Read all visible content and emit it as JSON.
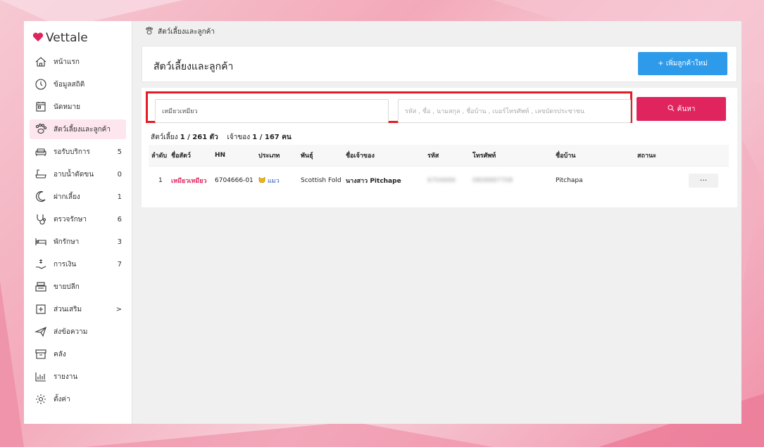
{
  "brand": {
    "name": "Vettale",
    "color": "#e0245e"
  },
  "sidebar": {
    "items": [
      {
        "label": "หน้าแรก",
        "icon": "home-icon",
        "count": ""
      },
      {
        "label": "ข้อมูลสถิติ",
        "icon": "clock-icon",
        "count": ""
      },
      {
        "label": "นัดหมาย",
        "icon": "calendar-icon",
        "count": ""
      },
      {
        "label": "สัตว์เลี้ยงและลูกค้า",
        "icon": "paw-icon",
        "count": "",
        "active": true
      },
      {
        "label": "รอรับบริการ",
        "icon": "sofa-icon",
        "count": "5"
      },
      {
        "label": "อาบน้ำตัดขน",
        "icon": "bathtub-icon",
        "count": "0"
      },
      {
        "label": "ฝากเลี้ยง",
        "icon": "moon-icon",
        "count": "1"
      },
      {
        "label": "ตรวจรักษา",
        "icon": "stethoscope-icon",
        "count": "6"
      },
      {
        "label": "พักรักษา",
        "icon": "bed-icon",
        "count": "3"
      },
      {
        "label": "การเงิน",
        "icon": "money-hand-icon",
        "count": "7"
      },
      {
        "label": "ขายปลีก",
        "icon": "cash-register-icon",
        "count": ""
      },
      {
        "label": "ส่วนเสริม",
        "icon": "plus-box-icon",
        "count": ">"
      },
      {
        "label": "ส่งข้อความ",
        "icon": "send-icon",
        "count": ""
      },
      {
        "label": "คลัง",
        "icon": "archive-icon",
        "count": ""
      },
      {
        "label": "รายงาน",
        "icon": "chart-icon",
        "count": ""
      },
      {
        "label": "ตั้งค่า",
        "icon": "gear-icon",
        "count": ""
      }
    ]
  },
  "breadcrumb": {
    "label": "สัตว์เลี้ยงและลูกค้า",
    "icon": "paw-icon"
  },
  "header": {
    "title": "สัตว์เลี้ยงและลูกค้า",
    "add_label": "+ เพิ่มลูกค้าใหม่"
  },
  "search": {
    "name_value": "เหมียวเหมียว",
    "query_placeholder": "รหัส , ชื่อ , นามสกุล , ชื่อบ้าน , เบอร์โทรศัพท์ , เลขบัตรประชาชน",
    "button_label": "ค้นหา"
  },
  "counts": {
    "pets_label": "สัตว์เลี้ยง",
    "pets_value": "1 / 261 ตัว",
    "owners_label": "เจ้าของ",
    "owners_value": "1 / 167 คน"
  },
  "table": {
    "headers": [
      "ลำดับ",
      "ชื่อสัตว์",
      "HN",
      "ประเภท",
      "พันธุ์",
      "ชื่อเจ้าของ",
      "รหัส",
      "โทรศัพท์",
      "ชื่อบ้าน",
      "สถานะ"
    ],
    "rows": [
      {
        "index": "1",
        "pet_name": "เหมียวเหมียว",
        "hn": "6704666-01",
        "type": "แมว",
        "breed": "Scottish Fold",
        "owner": "นางสาว Pitchape",
        "code": "6704666",
        "phone": "0808887708",
        "house_name": "Pitchapa",
        "status": "",
        "more": "···"
      }
    ]
  }
}
